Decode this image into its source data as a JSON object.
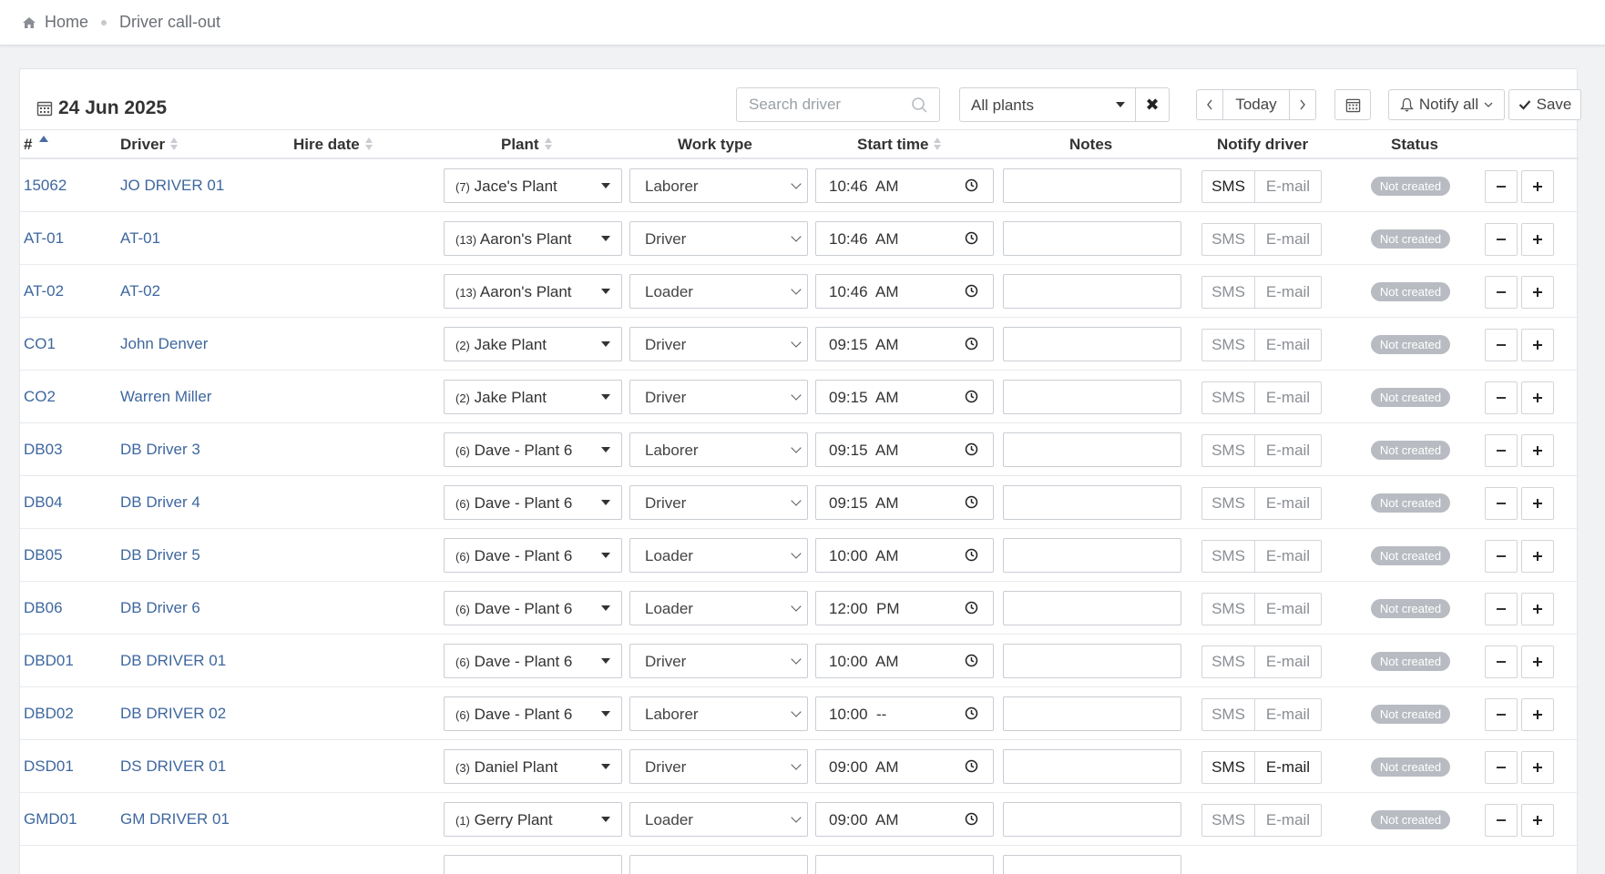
{
  "breadcrumb": {
    "home": "Home",
    "current": "Driver call-out"
  },
  "toolbar": {
    "date": "24 Jun 2025",
    "search_placeholder": "Search driver",
    "plant_filter": "All plants",
    "today": "Today",
    "notify_all": "Notify all",
    "save": "Save"
  },
  "columns": {
    "id": "#",
    "driver": "Driver",
    "hire_date": "Hire date",
    "plant": "Plant",
    "work_type": "Work type",
    "start_time": "Start time",
    "notes": "Notes",
    "notify_driver": "Notify driver",
    "status": "Status"
  },
  "labels": {
    "sms": "SMS",
    "email": "E-mail"
  },
  "rows": [
    {
      "id": "15062",
      "driver": "JO DRIVER 01",
      "plant_num": "(7)",
      "plant": "Jace's Plant",
      "work_type": "Laborer",
      "time": "10:46  AM",
      "sms_active": true,
      "email_active": false,
      "status": "Not created"
    },
    {
      "id": "AT-01",
      "driver": "AT-01",
      "plant_num": "(13)",
      "plant": "Aaron's Plant",
      "work_type": "Driver",
      "time": "10:46  AM",
      "sms_active": false,
      "email_active": false,
      "status": "Not created"
    },
    {
      "id": "AT-02",
      "driver": "AT-02",
      "plant_num": "(13)",
      "plant": "Aaron's Plant",
      "work_type": "Loader",
      "time": "10:46  AM",
      "sms_active": false,
      "email_active": false,
      "status": "Not created"
    },
    {
      "id": "CO1",
      "driver": "John Denver",
      "plant_num": "(2)",
      "plant": "Jake Plant",
      "work_type": "Driver",
      "time": "09:15  AM",
      "sms_active": false,
      "email_active": false,
      "status": "Not created"
    },
    {
      "id": "CO2",
      "driver": "Warren Miller",
      "plant_num": "(2)",
      "plant": "Jake Plant",
      "work_type": "Driver",
      "time": "09:15  AM",
      "sms_active": false,
      "email_active": false,
      "status": "Not created"
    },
    {
      "id": "DB03",
      "driver": "DB Driver 3",
      "plant_num": "(6)",
      "plant": "Dave - Plant 6",
      "work_type": "Laborer",
      "time": "09:15  AM",
      "sms_active": false,
      "email_active": false,
      "status": "Not created"
    },
    {
      "id": "DB04",
      "driver": "DB Driver 4",
      "plant_num": "(6)",
      "plant": "Dave - Plant 6",
      "work_type": "Driver",
      "time": "09:15  AM",
      "sms_active": false,
      "email_active": false,
      "status": "Not created"
    },
    {
      "id": "DB05",
      "driver": "DB Driver 5",
      "plant_num": "(6)",
      "plant": "Dave - Plant 6",
      "work_type": "Loader",
      "time": "10:00  AM",
      "sms_active": false,
      "email_active": false,
      "status": "Not created"
    },
    {
      "id": "DB06",
      "driver": "DB Driver 6",
      "plant_num": "(6)",
      "plant": "Dave - Plant 6",
      "work_type": "Loader",
      "time": "12:00  PM",
      "sms_active": false,
      "email_active": false,
      "status": "Not created"
    },
    {
      "id": "DBD01",
      "driver": "DB DRIVER 01",
      "plant_num": "(6)",
      "plant": "Dave - Plant 6",
      "work_type": "Driver",
      "time": "10:00  AM",
      "sms_active": false,
      "email_active": false,
      "status": "Not created"
    },
    {
      "id": "DBD02",
      "driver": "DB DRIVER 02",
      "plant_num": "(6)",
      "plant": "Dave - Plant 6",
      "work_type": "Laborer",
      "time": "10:00  --",
      "sms_active": false,
      "email_active": false,
      "status": "Not created"
    },
    {
      "id": "DSD01",
      "driver": "DS DRIVER 01",
      "plant_num": "(3)",
      "plant": "Daniel Plant",
      "work_type": "Driver",
      "time": "09:00  AM",
      "sms_active": true,
      "email_active": true,
      "status": "Not created"
    },
    {
      "id": "GMD01",
      "driver": "GM DRIVER 01",
      "plant_num": "(1)",
      "plant": "Gerry Plant",
      "work_type": "Loader",
      "time": "09:00  AM",
      "sms_active": false,
      "email_active": false,
      "status": "Not created"
    }
  ]
}
